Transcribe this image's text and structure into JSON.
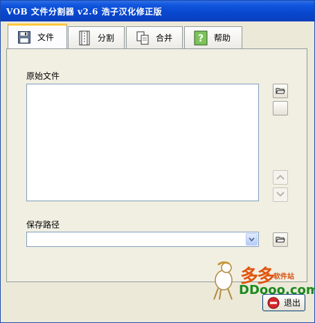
{
  "window": {
    "title": "VOB 文件分割器 v2.6 浩子汉化修正版"
  },
  "tabs": [
    {
      "label": "文件",
      "icon": "floppy-disk-icon",
      "active": true
    },
    {
      "label": "分割",
      "icon": "film-split-icon",
      "active": false
    },
    {
      "label": "合并",
      "icon": "copy-docs-icon",
      "active": false
    },
    {
      "label": "帮助",
      "icon": "help-question-icon",
      "active": false
    }
  ],
  "source": {
    "label": "原始文件",
    "files": []
  },
  "output": {
    "label": "保存路径",
    "value": ""
  },
  "buttons": {
    "exit_label": "退出"
  },
  "watermark": {
    "brand_cn": "多多",
    "sub": "软件站",
    "domain": "DDooo.com"
  },
  "colors": {
    "titlebar": "#0A46CF",
    "active_tab_highlight": "#FFC83C",
    "panel_bg": "#F1EFE2",
    "watermark_orange": "#E2540F",
    "watermark_green": "#1C8A1F"
  }
}
